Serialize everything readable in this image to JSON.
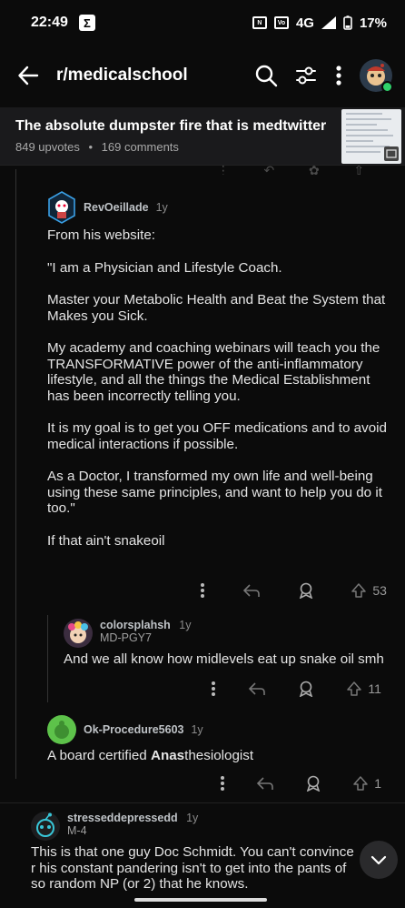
{
  "status_bar": {
    "time": "22:49",
    "sigma": "Σ",
    "network": "4G",
    "battery": "17%",
    "volte": "VoLTE",
    "nfc": "N"
  },
  "app_bar": {
    "subreddit": "r/medicalschool"
  },
  "post": {
    "title": "The absolute dumpster fire that is medtwitter",
    "upvotes": "849 upvotes",
    "separator": "•",
    "comments": "169 comments"
  },
  "comments": [
    {
      "user": "RevOeillade",
      "age": "1y",
      "paragraphs": [
        "From his website:",
        "\"I am a Physician and Lifestyle Coach.",
        "Master your Metabolic Health and Beat the System that Makes you Sick.",
        "My academy and coaching webinars will teach you the TRANSFORMATIVE power of the anti-inflammatory lifestyle, and all the things the Medical Establishment has been incorrectly telling you.",
        "It is my goal is to get you OFF medications and to avoid medical interactions if possible.",
        "As a Doctor, I transformed my own life and well-being using these same principles, and want to help you do it too.\"",
        "If that ain't snakeoil"
      ],
      "votes": "53"
    },
    {
      "user": "colorsplahsh",
      "age": "1y",
      "flair": "MD-PGY7",
      "body": "And we all know how midlevels eat up snake oil smh",
      "votes": "11"
    },
    {
      "user": "Ok-Procedure5603",
      "age": "1y",
      "body_pre": "A board certified ",
      "body_bold": "Anas",
      "body_post": "thesiologist",
      "votes": "1"
    },
    {
      "user": "stresseddepressedd",
      "age": "1y",
      "flair": "M-4",
      "body": "This is that one guy Doc Schmidt. You can't convince r his constant pandering isn't to get into the pants of so random NP (or 2) that he knows."
    }
  ],
  "colors": {
    "background": "#0b0b0b",
    "header": "#1a1a1c",
    "online": "#2fd16a",
    "text": "#e4e4e4",
    "muted": "#9a9a9a"
  }
}
